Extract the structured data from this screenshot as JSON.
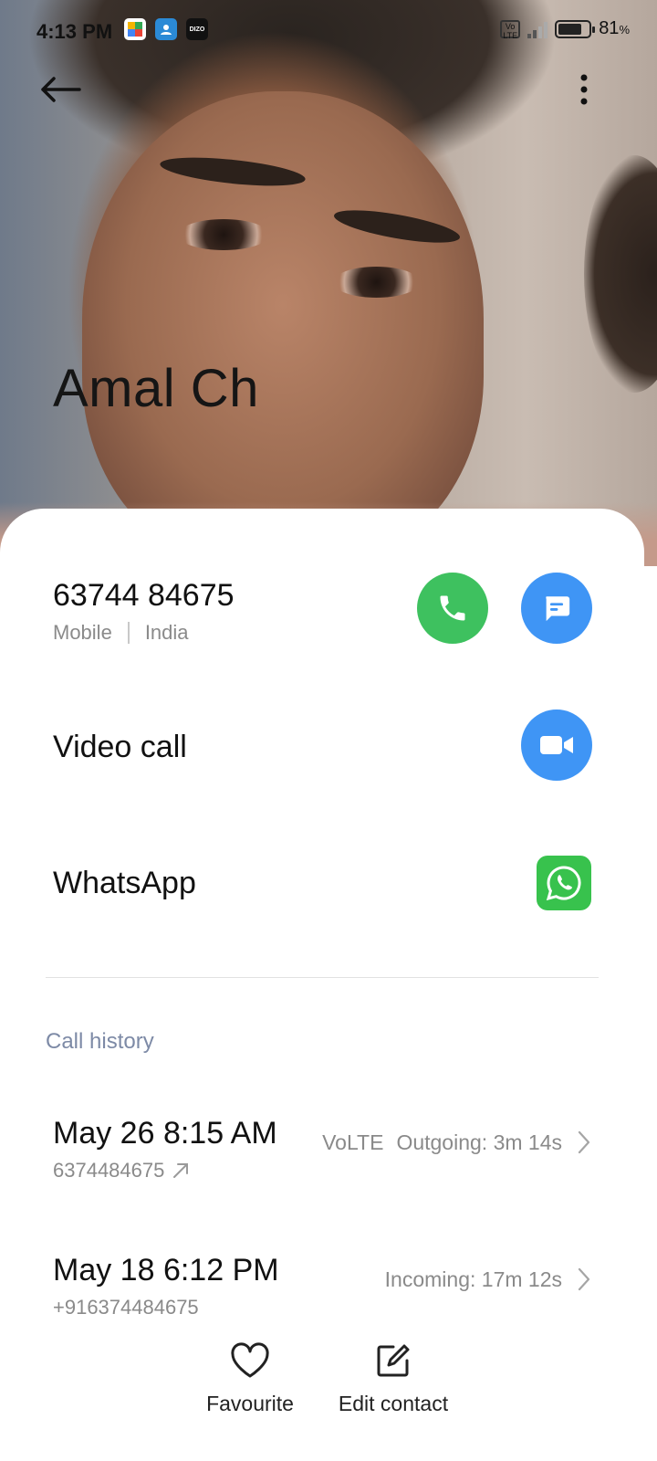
{
  "status_bar": {
    "time": "4:13 PM",
    "app_icons": [
      "photos-app-icon",
      "contacts-app-icon",
      "dizo-app-icon"
    ],
    "dizo_label": "DIZO",
    "volte": "Vo LTE",
    "battery_level": 81,
    "battery_text": "81",
    "battery_unit": "%"
  },
  "header": {
    "back_icon": "arrow-left-icon",
    "more_icon": "more-vertical-icon",
    "contact_name": "Amal Ch"
  },
  "phone": {
    "number": "63744 84675",
    "type": "Mobile",
    "region": "India",
    "call_icon": "phone-icon",
    "message_icon": "message-icon",
    "call_color": "#3ec15f",
    "message_color": "#3f95f5"
  },
  "actions": {
    "video_call_label": "Video call",
    "video_icon": "video-camera-icon",
    "whatsapp_label": "WhatsApp",
    "whatsapp_icon": "whatsapp-icon",
    "whatsapp_color": "#38c24d"
  },
  "call_history": {
    "title": "Call history",
    "items": [
      {
        "date": "May 26 8:15 AM",
        "number": "6374484675",
        "direction_icon": "outgoing-arrow-icon",
        "network": "VoLTE",
        "summary": "Outgoing: 3m 14s"
      },
      {
        "date": "May 18 6:12 PM",
        "number": "+916374484675",
        "network": "",
        "summary": "Incoming: 17m 12s"
      }
    ]
  },
  "bottom_bar": {
    "favourite_label": "Favourite",
    "favourite_icon": "heart-icon",
    "edit_label": "Edit contact",
    "edit_icon": "edit-icon"
  }
}
